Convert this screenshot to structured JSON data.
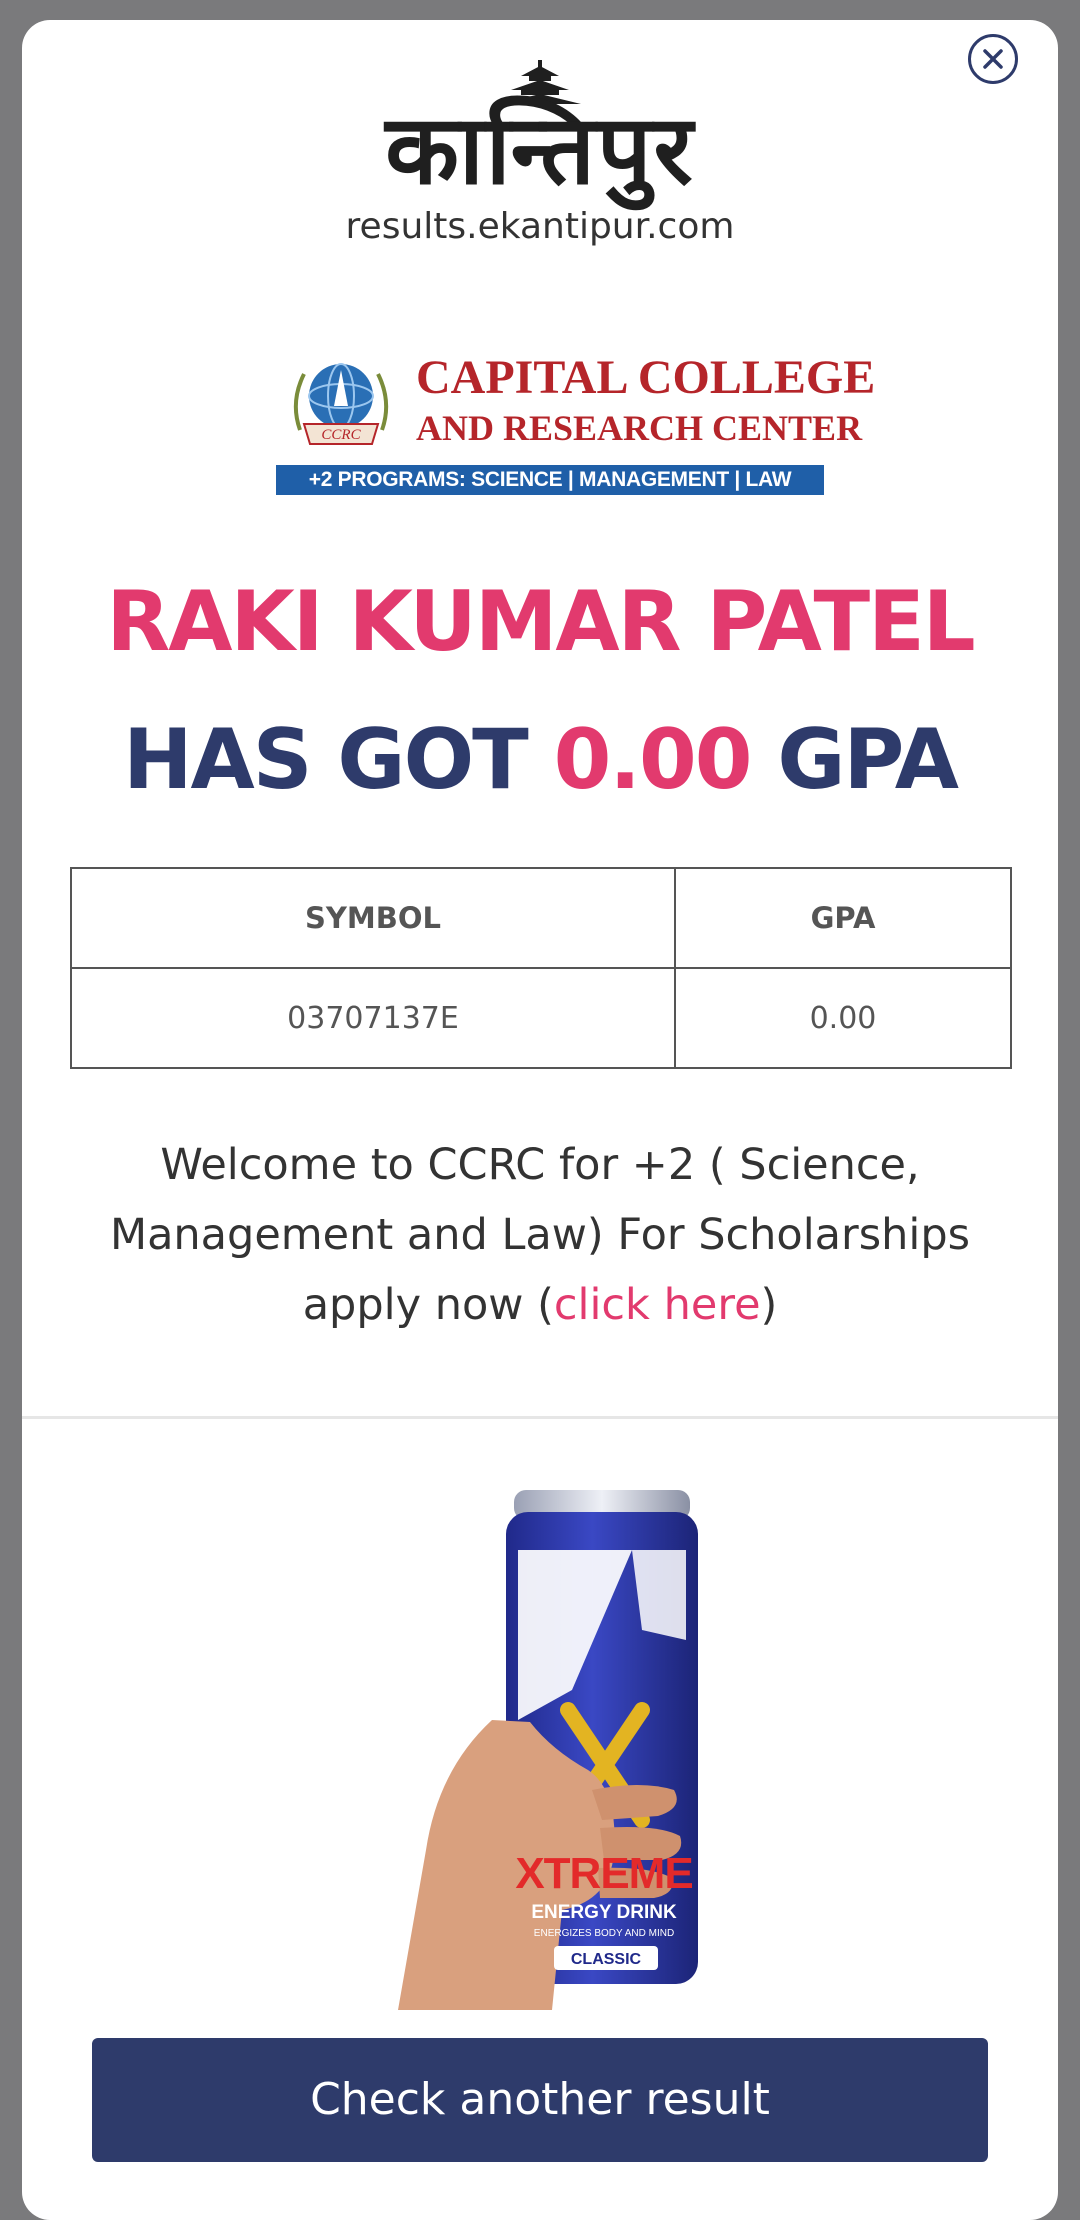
{
  "masthead": {
    "wordmark": "कान्तिपुर",
    "url": "results.ekantipur.com",
    "icon": "temple-roof-icon"
  },
  "close_icon": "close-icon",
  "college": {
    "emblem_icon": "globe-emblem-icon",
    "emblem_text": "CCRC",
    "name_line1": "CAPITAL COLLEGE",
    "name_line2": "AND RESEARCH CENTER",
    "programs": "+2 PROGRAMS: SCIENCE | MANAGEMENT | LAW"
  },
  "result": {
    "student_name": "RAKI KUMAR PATEL",
    "gpa_prefix": "HAS GOT",
    "gpa_value": "0.00",
    "gpa_suffix": "GPA"
  },
  "table": {
    "headers": [
      "SYMBOL",
      "GPA"
    ],
    "rows": [
      [
        "03707137E",
        "0.00"
      ]
    ]
  },
  "welcome": {
    "text_before": "Welcome to CCRC for +2 ( Science, Management and Law) For Scholarships apply now (",
    "link_text": "click here",
    "text_after": ")"
  },
  "ad": {
    "brand": "XTREME",
    "tagline": "ENERGY DRINK",
    "sub_tagline": "ENERGIZES BODY AND MIND",
    "variant": "CLASSIC",
    "icon": "energy-drink-can-ad"
  },
  "actions": {
    "check_another": "Check another result"
  },
  "colors": {
    "accent_pink": "#e23a6e",
    "navy": "#2e3b6b",
    "college_red": "#b5252a",
    "college_blue": "#1f5fa8"
  }
}
